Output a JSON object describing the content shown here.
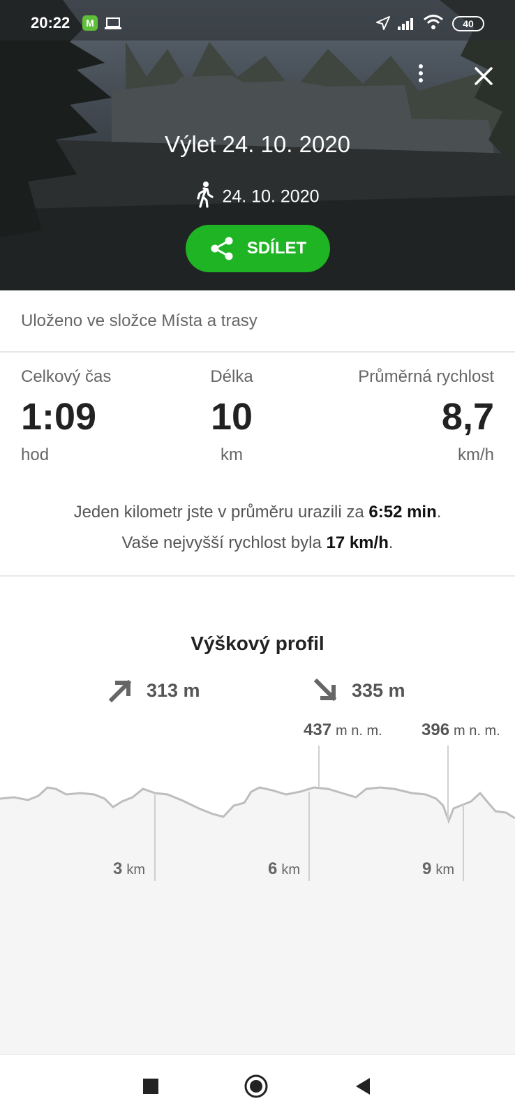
{
  "status_bar": {
    "time": "20:22",
    "app_badge": "M",
    "battery": "40"
  },
  "header": {
    "title": "Výlet 24. 10. 2020",
    "date": "24. 10. 2020",
    "activity_icon": "walking-person-icon",
    "share_label": "SDÍLET",
    "accent_color": "#1fb424"
  },
  "folder_text": "Uloženo ve složce Místa a trasy",
  "stats": [
    {
      "label": "Celkový čas",
      "value": "1:09",
      "unit": "hod"
    },
    {
      "label": "Délka",
      "value": "10",
      "unit": "km"
    },
    {
      "label": "Průměrná rychlost",
      "value": "8,7",
      "unit": "km/h"
    }
  ],
  "summary": {
    "line1_prefix": "Jeden kilometr jste v průměru urazili za ",
    "line1_value": "6:52 min",
    "line1_suffix": ".",
    "line2_prefix": "Vaše nejvyšší rychlost byla ",
    "line2_value": "17 km/h",
    "line2_suffix": "."
  },
  "elevation": {
    "title": "Výškový profil",
    "ascent": "313 m",
    "descent": "335 m",
    "peaks": [
      {
        "value": "437",
        "unit": "m n. m."
      },
      {
        "value": "396",
        "unit": "m n. m."
      }
    ],
    "km_markers": [
      {
        "value": "3",
        "unit": "km"
      },
      {
        "value": "6",
        "unit": "km"
      },
      {
        "value": "9",
        "unit": "km"
      }
    ]
  }
}
